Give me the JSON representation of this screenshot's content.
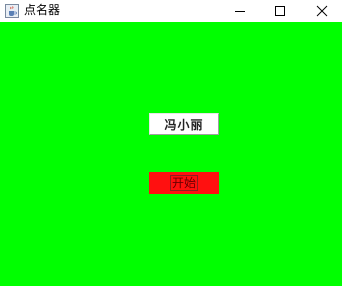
{
  "window": {
    "title": "点名器",
    "icons": {
      "app": "java-coffee-cup-icon",
      "minimize": "minimize-icon",
      "maximize": "maximize-icon",
      "close": "close-icon"
    }
  },
  "content": {
    "background_color": "#00ff00",
    "name_display": "冯小丽",
    "start_button_label": "开始",
    "start_button_color": "#ff1010"
  }
}
